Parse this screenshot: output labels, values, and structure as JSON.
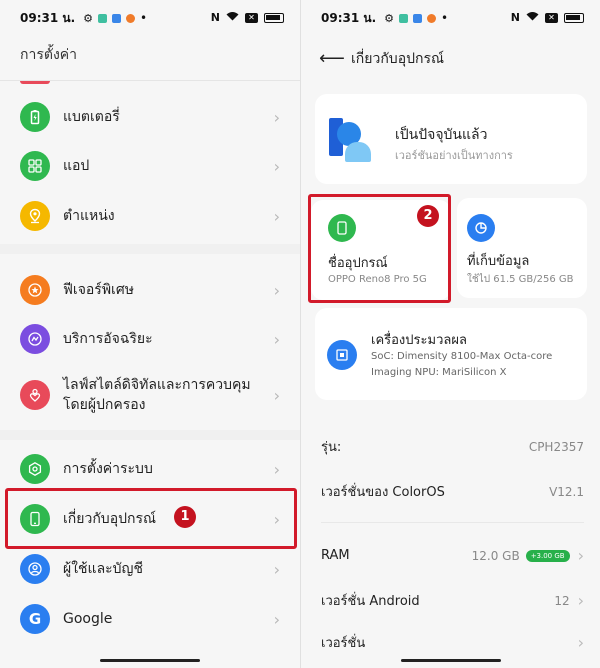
{
  "status": {
    "time": "09:31 น."
  },
  "left": {
    "title": "การตั้งค่า",
    "items": [
      {
        "label": "แบตเตอรี่",
        "color": "#2fb84f",
        "icon": "battery-icon"
      },
      {
        "label": "แอป",
        "color": "#2fb84f",
        "icon": "apps-grid-icon"
      },
      {
        "label": "ตำแหน่ง",
        "color": "#f5b800",
        "icon": "location-icon"
      },
      {
        "label": "ฟีเจอร์พิเศษ",
        "color": "#f57c1f",
        "icon": "star-icon"
      },
      {
        "label": "บริการอัจฉริยะ",
        "color": "#7b4de0",
        "icon": "smart-services-icon"
      },
      {
        "label": "ไลฟ์สไตล์ดิจิทัลและการควบคุมโดยผู้ปกครอง",
        "color": "#e84a5a",
        "icon": "heart-person-icon"
      },
      {
        "label": "การตั้งค่าระบบ",
        "color": "#2fb84f",
        "icon": "system-settings-icon"
      },
      {
        "label": "เกี่ยวกับอุปกรณ์",
        "color": "#2fb84f",
        "icon": "phone-icon"
      },
      {
        "label": "ผู้ใช้และบัญชี",
        "color": "#2a7ef0",
        "icon": "user-account-icon"
      },
      {
        "label": "Google",
        "color": "#2a7ef0",
        "icon": "google-icon"
      }
    ],
    "marker": "1"
  },
  "right": {
    "title": "เกี่ยวกับอุปกรณ์",
    "update_title": "เป็นปัจจุบันแล้ว",
    "update_sub": "เวอร์ชันอย่างเป็นทางการ",
    "device_name_label": "ชื่ออุปกรณ์",
    "device_name_value": "OPPO Reno8 Pro 5G",
    "storage_label": "ที่เก็บข้อมูล",
    "storage_value": "ใช้ไป 61.5 GB/256 GB",
    "processor_label": "เครื่องประมวลผล",
    "processor_soc": "SoC: Dimensity 8100-Max Octa-core",
    "processor_npu": "Imaging NPU: MariSilicon X",
    "marker": "2",
    "rows": [
      {
        "label": "รุ่น:",
        "value": "CPH2357"
      },
      {
        "label": "เวอร์ชั่นของ ColorOS",
        "value": "V12.1"
      },
      {
        "label": "RAM",
        "value": "12.0 GB",
        "badge": "+3.00 GB"
      },
      {
        "label": "เวอร์ชั่น Android",
        "value": "12"
      },
      {
        "label": "เวอร์ชั่น",
        "value": ""
      }
    ]
  }
}
